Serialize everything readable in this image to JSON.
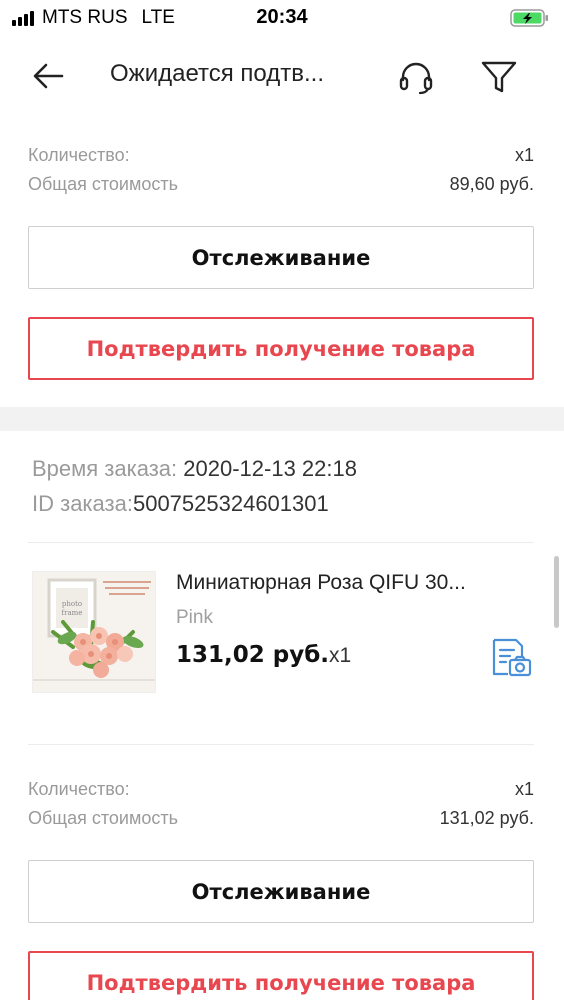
{
  "status_bar": {
    "carrier": "MTS RUS",
    "network": "LTE",
    "time": "20:34"
  },
  "header": {
    "title": "Ожидается подтв...",
    "back_icon": "arrow-left-icon",
    "support_icon": "headset-icon",
    "filter_icon": "funnel-icon"
  },
  "order_1": {
    "quantity_label": "Количество:",
    "quantity_value": "x1",
    "total_label": "Общая стоимость",
    "total_value": "89,60 руб.",
    "track_label": "Отслеживание",
    "confirm_label": "Подтвердить получение товара"
  },
  "order_2": {
    "time_label": "Время заказа:",
    "time_value": " 2020-12-13 22:18",
    "id_label": "ID заказа:",
    "id_value": "5007525324601301",
    "product": {
      "title": "Миниатюрная Роза QIFU 30...",
      "variant": "Pink",
      "price": "131,02 руб.",
      "qty": "x1"
    },
    "quantity_label": "Количество:",
    "quantity_value": "x1",
    "total_label": "Общая стоимость",
    "total_value": "131,02 руб.",
    "track_label": "Отслеживание",
    "confirm_label": "Подтвердить получение товара"
  },
  "colors": {
    "accent_red": "#e8474f",
    "review_icon_blue": "#4a90d9",
    "battery_green": "#4cd964"
  }
}
